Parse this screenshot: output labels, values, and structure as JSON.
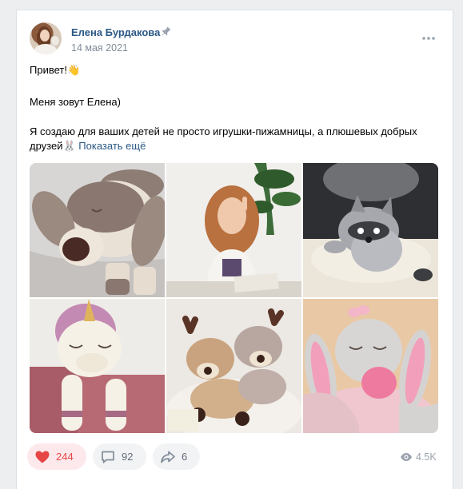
{
  "post": {
    "author": "Елена Бурдакова",
    "date": "14 мая 2021",
    "text_line1": "Привет!👋",
    "text_line2": "Меня зовут Елена)",
    "text_line3": "Я создаю для ваших детей не просто игрушки-пижамницы, а плюшевых добрых друзей🐰",
    "show_more": "Показать ещё"
  },
  "actions": {
    "likes": "244",
    "comments": "92",
    "shares": "6",
    "views": "4.5K"
  },
  "icons": [
    "avatar",
    "pin-icon",
    "more-icon",
    "heart-icon",
    "comment-icon",
    "share-icon",
    "eye-icon"
  ],
  "colors": {
    "link": "#2a5885",
    "like_red": "#e64646",
    "like_bg": "#fde9eb",
    "button_bg": "#f2f3f5",
    "muted": "#818c99"
  }
}
